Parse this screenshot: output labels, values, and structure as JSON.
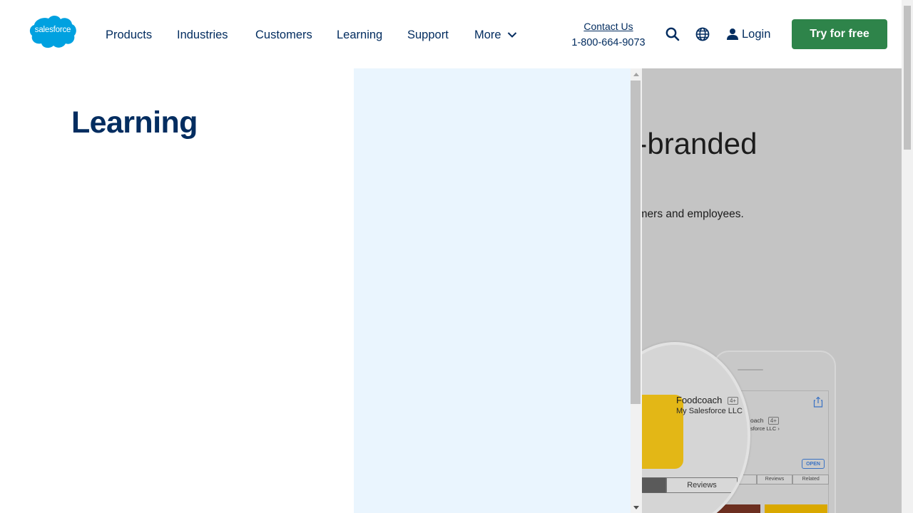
{
  "header": {
    "logo_text": "salesforce",
    "nav": [
      "Products",
      "Industries",
      "Customers",
      "Learning",
      "Support",
      "More"
    ],
    "contact_label": "Contact Us",
    "phone": "1-800-664-9073",
    "search_icon": "search-icon",
    "globe_icon": "globe-icon",
    "login_label": "Login",
    "cta_label": "Try for free",
    "cta_color": "#2e844a",
    "brand_color": "#00a1e0",
    "text_color": "#032d60"
  },
  "menu": {
    "title": "Learning",
    "panel_color": "#eaf5fe"
  },
  "hero": {
    "heading_fragment": "n-branded",
    "sub_fragment": "omers and employees.",
    "app_name": "Foodcoach",
    "app_age": "4+",
    "app_developer": "My Salesforce LLC",
    "small_app_name": "oach",
    "small_age": "4+",
    "small_developer": "sforce LLC ›",
    "open_label": "OPEN",
    "mag_tab_label": "Reviews",
    "small_tabs": [
      "",
      "Reviews",
      "Related"
    ]
  }
}
